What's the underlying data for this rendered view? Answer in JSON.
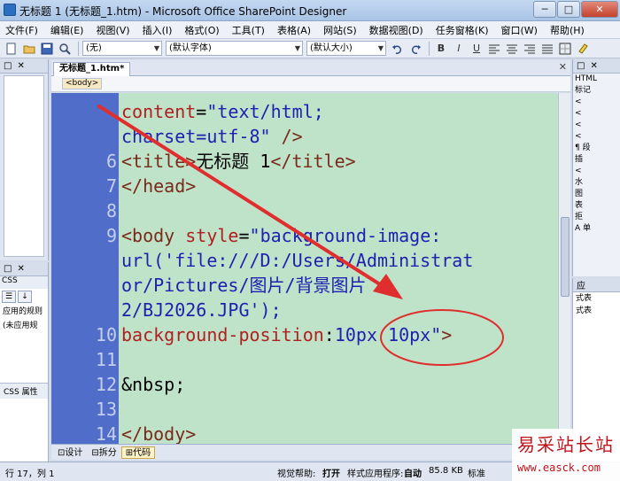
{
  "window": {
    "title": "无标题 1 (无标题_1.htm) - Microsoft Office SharePoint Designer",
    "minimize": "─",
    "maximize": "□",
    "close": "✕"
  },
  "menu": [
    "文件(F)",
    "编辑(E)",
    "视图(V)",
    "插入(I)",
    "格式(O)",
    "工具(T)",
    "表格(A)",
    "网站(S)",
    "数据视图(D)",
    "任务窗格(K)",
    "窗口(W)",
    "帮助(H)"
  ],
  "toolbar": {
    "style_combo": "(无)",
    "font_combo": "(默认字体)",
    "size_combo": "(默认大小)",
    "bold": "B",
    "italic": "I",
    "underline": "U"
  },
  "document": {
    "tab_label": "无标题_1.htm*",
    "close_glyph": "✕",
    "quick_tag": "<body>"
  },
  "code_lines": [
    {
      "num": "",
      "segments": [
        {
          "cls": "attr",
          "text": "content"
        },
        {
          "cls": "txt",
          "text": "="
        },
        {
          "cls": "val",
          "text": "\"text/html;"
        }
      ]
    },
    {
      "num": "",
      "segments": [
        {
          "cls": "val",
          "text": "charset=utf-8\""
        },
        {
          "cls": "txt",
          "text": " "
        },
        {
          "cls": "tag",
          "text": "/>"
        }
      ]
    },
    {
      "num": "6",
      "segments": [
        {
          "cls": "tag",
          "text": "<title>"
        },
        {
          "cls": "txt",
          "text": "无标题 1"
        },
        {
          "cls": "tag",
          "text": "</title>"
        }
      ]
    },
    {
      "num": "7",
      "segments": [
        {
          "cls": "tag",
          "text": "</head>"
        }
      ]
    },
    {
      "num": "8",
      "segments": []
    },
    {
      "num": "9",
      "segments": [
        {
          "cls": "tag",
          "text": "<body"
        },
        {
          "cls": "txt",
          "text": " "
        },
        {
          "cls": "attr",
          "text": "style"
        },
        {
          "cls": "txt",
          "text": "="
        },
        {
          "cls": "val",
          "text": "\"background-image:"
        }
      ]
    },
    {
      "num": "",
      "segments": [
        {
          "cls": "val",
          "text": "url('file:///D:/Users/Administrat"
        }
      ]
    },
    {
      "num": "",
      "segments": [
        {
          "cls": "val",
          "text": "or/Pictures/图片/背景图片"
        }
      ]
    },
    {
      "num": "",
      "segments": [
        {
          "cls": "val",
          "text": "2/BJ2026.JPG');"
        }
      ]
    },
    {
      "num": "10",
      "segments": [
        {
          "cls": "attr",
          "text": "background-position"
        },
        {
          "cls": "txt",
          "text": ":"
        },
        {
          "cls": "val",
          "text": "10px 10px\""
        },
        {
          "cls": "tag",
          "text": ">"
        }
      ]
    },
    {
      "num": "11",
      "segments": []
    },
    {
      "num": "12",
      "segments": [
        {
          "cls": "txt",
          "text": "&nbsp;"
        }
      ]
    },
    {
      "num": "13",
      "segments": []
    },
    {
      "num": "14",
      "segments": [
        {
          "cls": "tag",
          "text": "</body>"
        }
      ]
    }
  ],
  "view_tabs": [
    "设计",
    "拆分",
    "代码"
  ],
  "left_panel": {
    "css_tab": "CSS",
    "css_text_1": "应用的规则",
    "css_text_2": "(未应用规",
    "css_props": "CSS 属性"
  },
  "right_panel": {
    "head": "HTML",
    "items": [
      "标记",
      "<",
      "<",
      "<",
      "<",
      "¶ 段",
      "插",
      "<",
      "水",
      "图"
    ],
    "group2": "表",
    "group2_items": [
      "拒",
      "A 单"
    ],
    "bottom_head": "应",
    "bottom_items": [
      "式表",
      "式表"
    ]
  },
  "status": {
    "position": "行 17，列 1",
    "visual_aid_label": "视觉帮助:",
    "visual_aid_value": "打开",
    "style_app_label": "样式应用程序:",
    "style_app_value": "自动",
    "size": "85.8 KB",
    "mode": "标准"
  },
  "watermark": {
    "title": "易采站长站",
    "url": "www.easck.com"
  },
  "colors": {
    "code_bg": "#bfe3c9",
    "gutter": "#4f6dc9",
    "annotation_red": "#e02e2e"
  }
}
